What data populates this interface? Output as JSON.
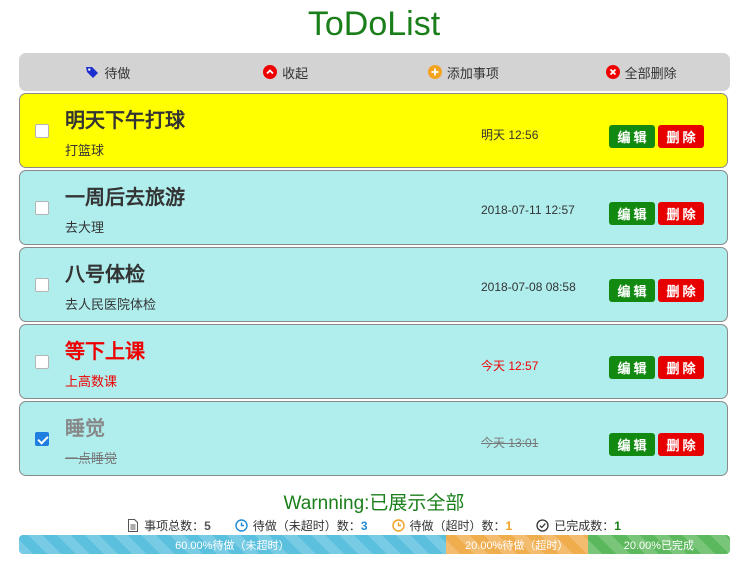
{
  "app": {
    "title": "ToDoList"
  },
  "toolbar": {
    "todo_label": "待做",
    "collapse_label": "收起",
    "add_label": "添加事项",
    "delete_all_label": "全部删除"
  },
  "items": [
    {
      "title": "明天下午打球",
      "desc": "打篮球",
      "time": "明天 12:56",
      "checked": false
    },
    {
      "title": "一周后去旅游",
      "desc": "去大理",
      "time": "2018-07-11 12:57",
      "checked": false
    },
    {
      "title": "八号体检",
      "desc": "去人民医院体检",
      "time": "2018-07-08 08:58",
      "checked": false
    },
    {
      "title": "等下上课",
      "desc": "上高数课",
      "time": "今天 12:57",
      "checked": false
    },
    {
      "title": "睡觉",
      "desc": "一点睡觉",
      "time": "今天 13:01",
      "checked": true
    }
  ],
  "buttons": {
    "edit": "编辑",
    "delete": "删除"
  },
  "warning": "Warnning:已展示全部",
  "stats": {
    "total_label": "事项总数：",
    "total": "5",
    "pending_label": "待做（未超时）数：",
    "pending": "3",
    "overdue_label": "待做（超时）数：",
    "overdue": "1",
    "done_label": "已完成数：",
    "done": "1"
  },
  "progress": {
    "pending_text": "60.00%待做（未超时）",
    "pending_pct": 60,
    "overdue_text": "20.00%待做（超时）",
    "overdue_pct": 20,
    "done_text": "20.00%已完成",
    "done_pct": 20
  },
  "colors": {
    "title": "#1a7f1a",
    "active_item": "#ffff00",
    "item_bg": "#b0eeee",
    "overdue": "#e00000",
    "edit_button": "#128a12",
    "delete_button": "#e70000"
  }
}
